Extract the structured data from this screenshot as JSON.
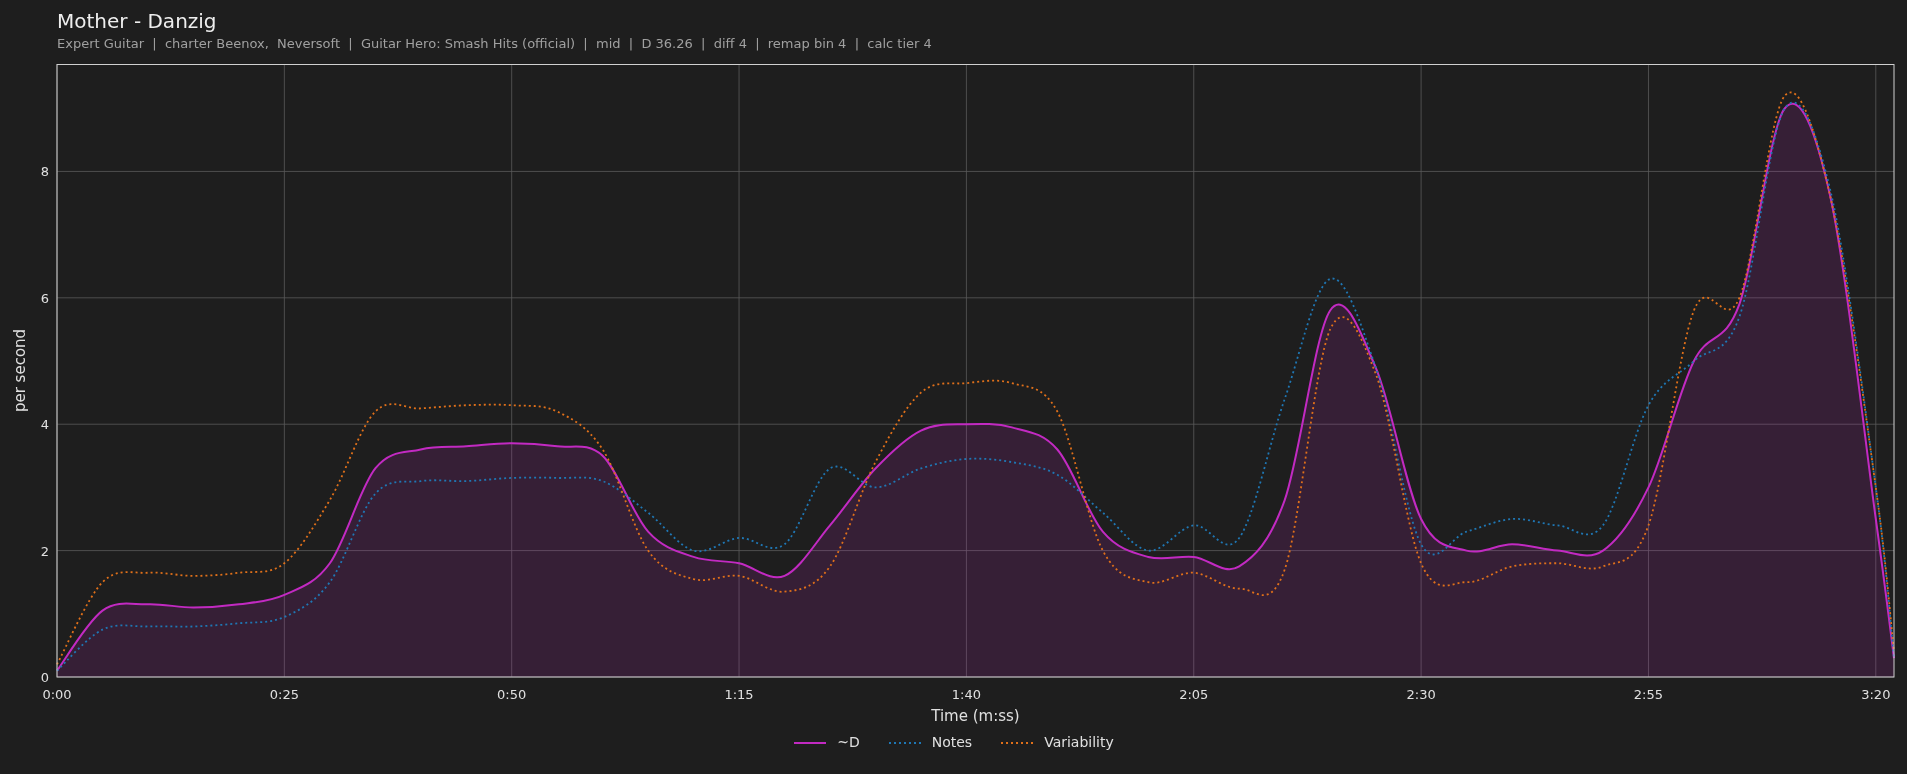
{
  "title": "Mother - Danzig",
  "subtitle": "Expert Guitar  |  charter Beenox,  Neversoft  |  Guitar Hero: Smash Hits (official)  |  mid  |  D 36.26  |  diff 4  |  remap bin 4  |  calc tier 4",
  "chart_data": {
    "type": "line",
    "xlabel": "Time (m:ss)",
    "ylabel": "per second",
    "x": [
      0,
      5,
      10,
      15,
      20,
      25,
      30,
      35,
      40,
      45,
      50,
      55,
      60,
      65,
      70,
      75,
      80,
      85,
      90,
      95,
      100,
      105,
      110,
      115,
      120,
      125,
      130,
      135,
      140,
      145,
      150,
      155,
      160,
      165,
      170,
      175,
      180,
      185,
      190,
      195,
      200,
      202
    ],
    "series": [
      {
        "name": "~D",
        "color": "#c22ac2",
        "line_style": "solid",
        "type": "area",
        "values": [
          0.1,
          1.05,
          1.15,
          1.1,
          1.15,
          1.3,
          1.8,
          3.3,
          3.6,
          3.65,
          3.7,
          3.65,
          3.5,
          2.3,
          1.9,
          1.8,
          1.6,
          2.4,
          3.3,
          3.9,
          4.0,
          3.95,
          3.6,
          2.3,
          1.9,
          1.9,
          1.75,
          2.8,
          5.8,
          4.9,
          2.5,
          2.0,
          2.1,
          2.0,
          2.0,
          3.0,
          5.0,
          5.9,
          9.0,
          7.6,
          2.5,
          0.3
        ]
      },
      {
        "name": "Notes",
        "color": "#1f77b4",
        "line_style": "dotted",
        "type": "line",
        "values": [
          0.1,
          0.75,
          0.8,
          0.8,
          0.85,
          0.95,
          1.5,
          2.9,
          3.1,
          3.1,
          3.15,
          3.15,
          3.1,
          2.6,
          2.0,
          2.2,
          2.1,
          3.3,
          3.0,
          3.3,
          3.45,
          3.4,
          3.2,
          2.6,
          2.0,
          2.4,
          2.2,
          4.4,
          6.3,
          4.9,
          2.1,
          2.3,
          2.5,
          2.4,
          2.4,
          4.3,
          5.0,
          5.7,
          9.0,
          7.7,
          3.0,
          0.3
        ]
      },
      {
        "name": "Variability",
        "color": "#e0701a",
        "line_style": "dotted",
        "type": "line",
        "values": [
          0.2,
          1.5,
          1.65,
          1.6,
          1.65,
          1.8,
          2.8,
          4.2,
          4.25,
          4.3,
          4.3,
          4.2,
          3.6,
          2.0,
          1.55,
          1.6,
          1.35,
          1.75,
          3.4,
          4.5,
          4.65,
          4.65,
          4.2,
          2.0,
          1.5,
          1.65,
          1.4,
          1.7,
          5.5,
          4.8,
          1.8,
          1.5,
          1.75,
          1.8,
          1.75,
          2.4,
          5.8,
          6.0,
          9.2,
          7.6,
          3.0,
          0.4
        ]
      }
    ],
    "xlim": [
      0,
      202
    ],
    "ylim": [
      0,
      9.7
    ],
    "xticks": [
      {
        "value": 0,
        "label": "0:00"
      },
      {
        "value": 25,
        "label": "0:25"
      },
      {
        "value": 50,
        "label": "0:50"
      },
      {
        "value": 75,
        "label": "1:15"
      },
      {
        "value": 100,
        "label": "1:40"
      },
      {
        "value": 125,
        "label": "2:05"
      },
      {
        "value": 150,
        "label": "2:30"
      },
      {
        "value": 175,
        "label": "2:55"
      },
      {
        "value": 200,
        "label": "3:20"
      }
    ],
    "yticks": [
      0,
      2,
      4,
      6,
      8
    ],
    "grid": true
  }
}
